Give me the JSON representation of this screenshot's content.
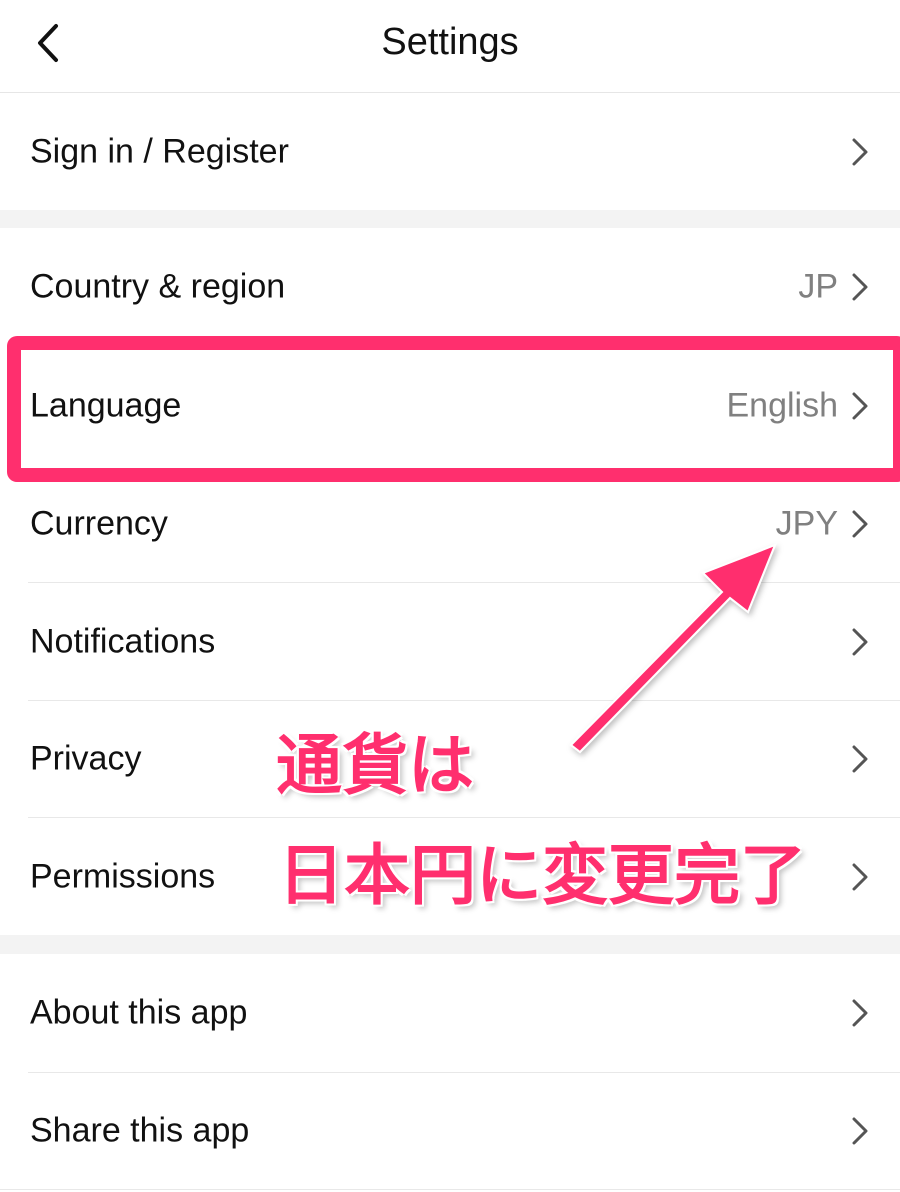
{
  "header": {
    "title": "Settings",
    "back_icon": "chevron-left-icon"
  },
  "rows": {
    "sign_in": {
      "label": "Sign in / Register",
      "value": ""
    },
    "country": {
      "label": "Country & region",
      "value": "JP"
    },
    "language": {
      "label": "Language",
      "value": "English"
    },
    "currency": {
      "label": "Currency",
      "value": "JPY"
    },
    "notifications": {
      "label": "Notifications",
      "value": ""
    },
    "privacy": {
      "label": "Privacy",
      "value": ""
    },
    "permissions": {
      "label": "Permissions",
      "value": ""
    },
    "about": {
      "label": "About this app",
      "value": ""
    },
    "share": {
      "label": "Share this app",
      "value": ""
    }
  },
  "annotation": {
    "line1": "通貨は",
    "line2": "日本円に変更完了",
    "color": "#ff2f6e"
  },
  "colors": {
    "accent": "#ff2f6e",
    "secondary_text": "#808080",
    "section_gap": "#f3f3f3"
  }
}
